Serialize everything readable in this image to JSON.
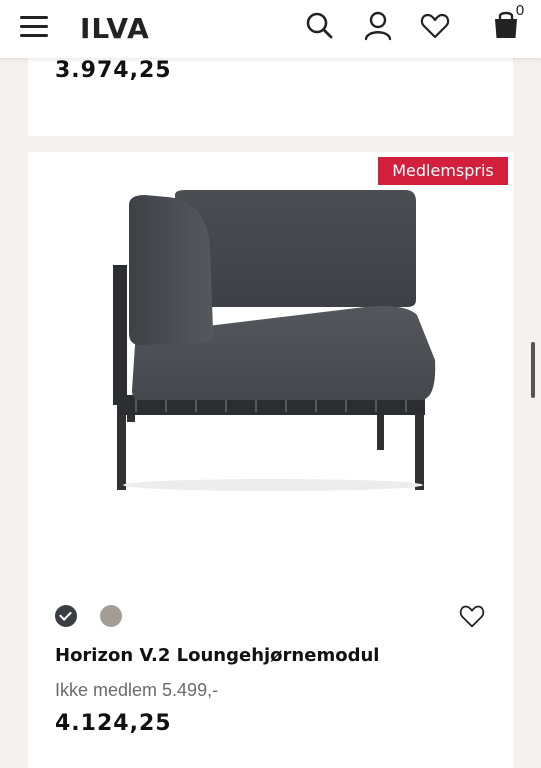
{
  "header": {
    "logo": "ILVA",
    "cart_count": "0"
  },
  "previous_product": {
    "price": "3.974,25"
  },
  "product": {
    "badge": "Medlemspris",
    "name": "Horizon V.2 Loungehjørnemodul",
    "non_member_price": "Ikke medlem 5.499,-",
    "member_price": "4.124,25",
    "swatches": [
      {
        "name": "dark-grey",
        "color": "#3a3d42",
        "selected": true
      },
      {
        "name": "beige",
        "color": "#a39e93",
        "selected": false
      }
    ]
  },
  "colors": {
    "promo_red": "#d21f3c",
    "page_bg": "#f4f1ef"
  }
}
